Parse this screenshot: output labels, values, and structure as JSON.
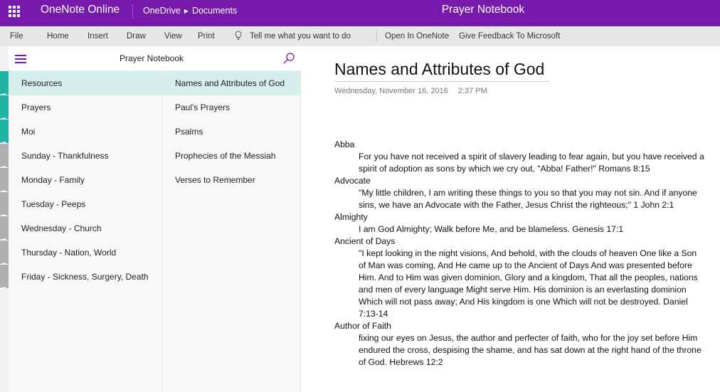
{
  "topbar": {
    "app_name": "OneNote Online",
    "breadcrumb": [
      "OneDrive",
      "Documents"
    ],
    "notebook_title": "Prayer Notebook",
    "color": "#7719aa"
  },
  "menubar": {
    "items": [
      "File",
      "Home",
      "Insert",
      "Draw",
      "View",
      "Print"
    ],
    "tell_me": "Tell me what you want to do",
    "open_in_onenote": "Open In OneNote",
    "feedback": "Give Feedback To Microsoft"
  },
  "nav": {
    "title": "Prayer Notebook",
    "sections": [
      {
        "label": "Resources",
        "selected": true,
        "tab_color": "#1fb3a3"
      },
      {
        "label": "Prayers",
        "selected": false,
        "tab_color": "#1fb3a3"
      },
      {
        "label": "Moi",
        "selected": false,
        "tab_color": "#1fb3a3"
      },
      {
        "label": "Sunday - Thankfulness",
        "selected": false,
        "tab_color": "#b0b0b0"
      },
      {
        "label": "Monday - Family",
        "selected": false,
        "tab_color": "#b0b0b0"
      },
      {
        "label": "Tuesday - Peeps",
        "selected": false,
        "tab_color": "#b0b0b0"
      },
      {
        "label": "Wednesday - Church",
        "selected": false,
        "tab_color": "#b0b0b0"
      },
      {
        "label": "Thursday - Nation, World",
        "selected": false,
        "tab_color": "#b0b0b0"
      },
      {
        "label": "Friday - Sickness, Surgery, Death",
        "selected": false,
        "tab_color": "#b0b0b0"
      }
    ],
    "pages": [
      {
        "label": "Names and Attributes of God",
        "selected": true
      },
      {
        "label": "Paul's Prayers",
        "selected": false
      },
      {
        "label": "Psalms",
        "selected": false
      },
      {
        "label": "Prophecies of the Messiah",
        "selected": false
      },
      {
        "label": "Verses to Remember",
        "selected": false
      }
    ]
  },
  "page": {
    "title": "Names and Attributes of God",
    "date": "Wednesday, November 16, 2016",
    "time": "2:37 PM",
    "entries": [
      {
        "term": "Abba",
        "text": "For you have not received a spirit of slavery leading to fear again, but you have received a spirit of adoption as sons by which we cry out, \"Abba! Father!\" Romans 8:15"
      },
      {
        "term": "Advocate",
        "text": "\"My little children, I am writing these things to you so that you may not sin. And if anyone sins, we have an Advocate with the Father, Jesus Christ the righteous;\" 1 John 2:1"
      },
      {
        "term": "Almighty",
        "text": "I am God Almighty; Walk before Me, and be blameless. Genesis 17:1"
      },
      {
        "term": "Ancient of Days",
        "text": "\"I kept looking in the night visions, And behold, with the clouds of heaven One like a Son of Man was coming, And He came up to the Ancient of Days And was presented before Him. And to Him was given dominion, Glory and a kingdom, That all the peoples, nations and men of every language Might serve Him. His dominion is an everlasting dominion Which will not pass away; And His kingdom is one Which will not be destroyed. Daniel 7:13-14"
      },
      {
        "term": "Author of Faith",
        "text": "fixing our eyes on Jesus, the author and perfecter of faith, who for the joy set before Him endured the cross, despising the shame, and has sat down at the right hand of the throne of God. Hebrews 12:2"
      }
    ]
  }
}
